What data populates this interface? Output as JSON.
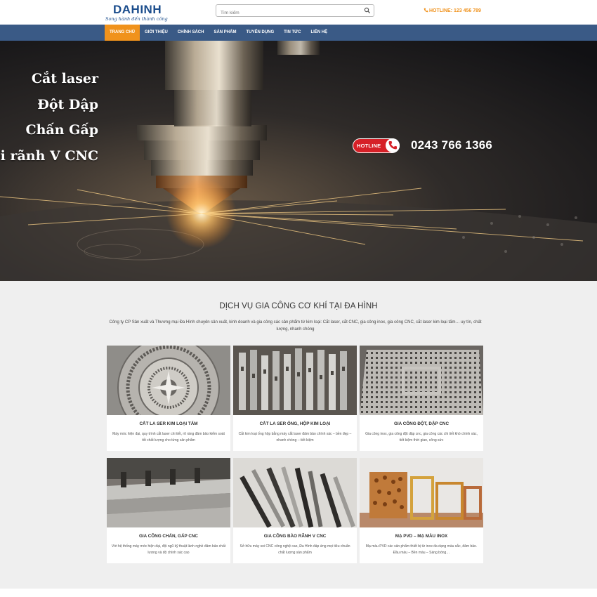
{
  "header": {
    "logo_main": "DAHINH",
    "logo_sub": "Song hành đến thành công",
    "search_placeholder": "Tìm kiếm",
    "hotline": "HOTLINE: 123 456 789"
  },
  "nav": {
    "items": [
      {
        "label": "Trang chủ",
        "active": true
      },
      {
        "label": "Giới thiệu"
      },
      {
        "label": "Chính sách"
      },
      {
        "label": "Sản phẩm"
      },
      {
        "label": "Tuyển dụng"
      },
      {
        "label": "Tin tức"
      },
      {
        "label": "Liên hệ"
      }
    ]
  },
  "hero": {
    "lines": [
      "Cắt laser",
      "Đột Dập",
      "Chấn Gấp",
      "oi rãnh V CNC"
    ],
    "hotline_badge": "HOTLINE",
    "phone": "0243 766 1366"
  },
  "services": {
    "title": "DỊCH VỤ GIA CÔNG CƠ KHÍ TẠI ĐA HÌNH",
    "description": "Công ty CP Sản xuất và Thương mại Đa Hình chuyên sản xuất, kinh doanh và gia công các sản phẩm từ kim loại: Cắt laser, cắt CNC, gia công inox, gia công CNC, cắt laser kim loại tấm… uy tín, chất lượng, nhanh chóng",
    "cards": [
      {
        "title": "CẮT LA SER KIM LOẠI TẤM",
        "desc": "Máy móc hiện đại, quy trình cắt laser chi tiết, rõ ràng đảm bảo kiểm soát tốt chất lượng cho từng sản phẩm"
      },
      {
        "title": "CẮT LA SER ỐNG, HỘP KIM LOẠI",
        "desc": "Cắt kim loại ống hộp bằng máy cắt laser đảm bảo chính xác – bền đẹp – nhanh chóng – tiết kiệm"
      },
      {
        "title": "GIA CÔNG ĐỘT, DẬP CNC",
        "desc": "Gia công inox, gia công đột dập cnc, gia công các chi tiết khó chính xác, tiết kiệm thời gian, công sức"
      },
      {
        "title": "GIA CÔNG CHẤN, GẤP CNC",
        "desc": "Với hệ thống máy móc hiện đại, đội ngũ kỹ thuật lành nghề đảm bảo chất lượng và độ chính xác cao"
      },
      {
        "title": "GIA CÔNG BÀO RÃNH V CNC",
        "desc": "Sở hữu máy soi CNC công nghệ cao, Đa Hình đáp ứng mọi tiêu chuẩn chất lượng sản phẩm"
      },
      {
        "title": "MẠ PVD – MẠ MÀU INOX",
        "desc": "Mạ màu PVD các sản phẩm thiết bị từ inox đa dạng màu sắc, đảm bảo. Đầu màu – Bền màu – Sáng bóng…"
      }
    ]
  },
  "colors": {
    "nav_bg": "#3a5a86",
    "accent": "#f0921c",
    "logo_blue": "#1b4d8c",
    "hotline_red": "#d62027"
  }
}
